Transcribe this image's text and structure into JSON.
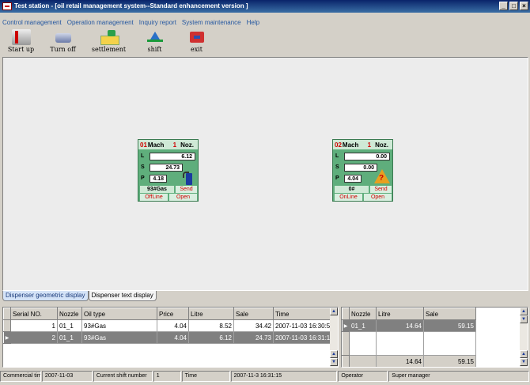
{
  "window": {
    "title": "Test station - [oil retail management system--Standard enhancement version ]"
  },
  "menu": [
    "Control management",
    "Operation management",
    "Inquiry report",
    "System maintenance",
    "Help"
  ],
  "toolbar": [
    {
      "label": "Start up",
      "icon": "start-up-icon"
    },
    {
      "label": "Turn off",
      "icon": "turn-off-icon"
    },
    {
      "label": "settlement",
      "icon": "settlement-icon"
    },
    {
      "label": "shift",
      "icon": "shift-icon"
    },
    {
      "label": "exit",
      "icon": "exit-icon"
    }
  ],
  "dispensers": [
    {
      "no": "01",
      "mach": "Mach",
      "noz_num": "1",
      "noz": "Noz.",
      "L": "6.12",
      "S": "24.73",
      "P": "4.18",
      "oil": "93#Gas",
      "send": "Send",
      "line": "OffLine",
      "open": "Open",
      "status_icon": "fuel-nozzle-icon"
    },
    {
      "no": "02",
      "mach": "Mach",
      "noz_num": "1",
      "noz": "Noz.",
      "L": "0.00",
      "S": "0.00",
      "P": "4.04",
      "oil": "0#",
      "send": "Send",
      "line": "OnLine",
      "open": "Open",
      "status_icon": "warning-question-icon"
    }
  ],
  "tabs": [
    "Dispenser geometric display",
    "Dispenser text display"
  ],
  "left_grid": {
    "headers": [
      "Serial NO.",
      "Nozzle",
      "Oil type",
      "Price",
      "Litre",
      "Sale",
      "Time"
    ],
    "rows": [
      [
        "1",
        "01_1",
        "93#Gas",
        "4.04",
        "8.52",
        "34.42",
        "2007-11-03 16:30:5"
      ],
      [
        "2",
        "01_1",
        "93#Gas",
        "4.04",
        "6.12",
        "24.73",
        "2007-11-03 16:31:1"
      ]
    ]
  },
  "right_grid": {
    "headers": [
      "Nozzle",
      "Litre",
      "Sale"
    ],
    "rows": [
      [
        "01_1",
        "14.64",
        "59.15"
      ]
    ],
    "totals": [
      "14.64",
      "59.15"
    ]
  },
  "statusbar": {
    "commercial_time_label": "Commercial time",
    "commercial_time": "2007-11-03",
    "shift_label": "Current shift number",
    "shift": "1",
    "time_label": "Time",
    "time": "2007-11-3 16:31:15",
    "operator_label": "Operator",
    "operator": "Super manager"
  }
}
